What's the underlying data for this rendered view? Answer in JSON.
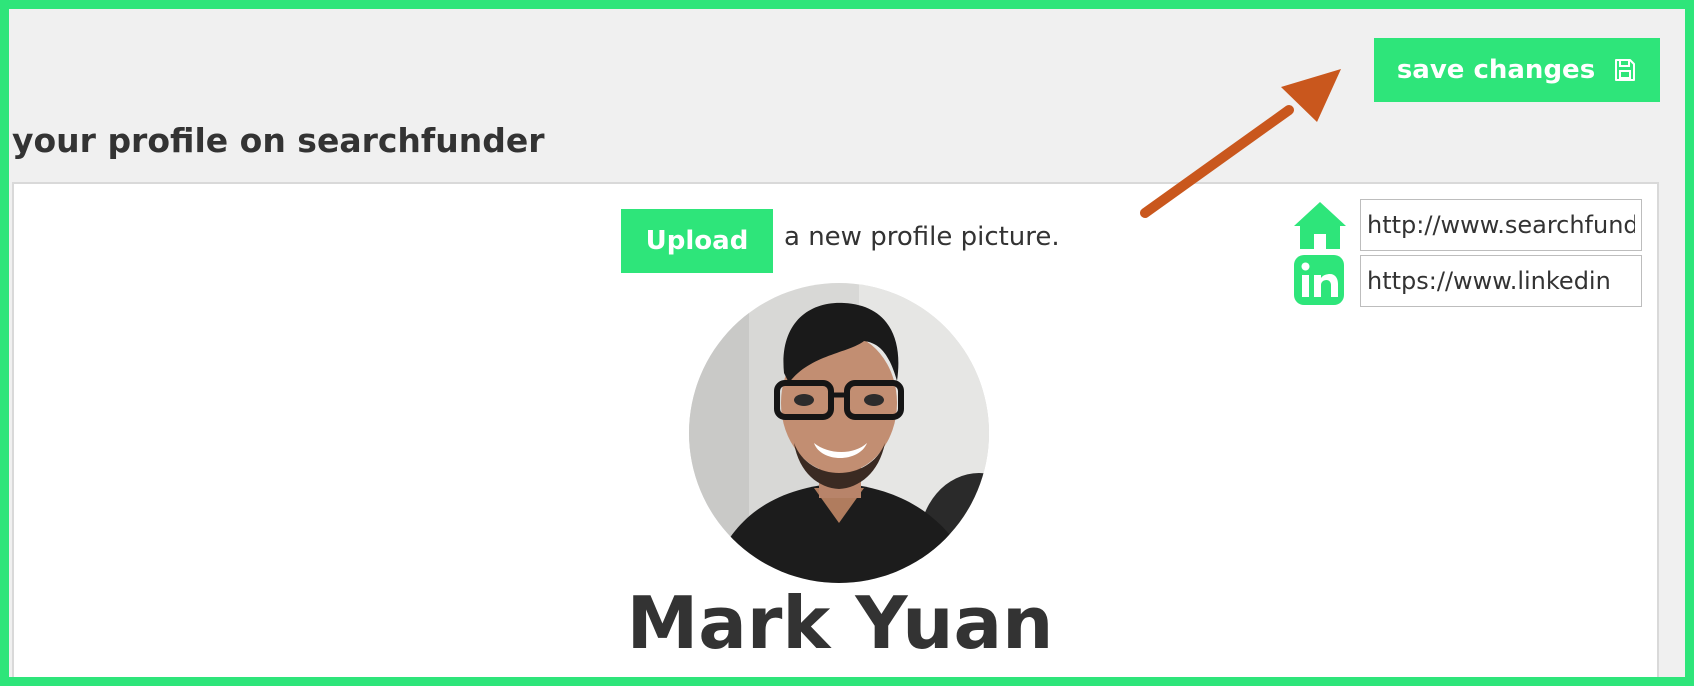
{
  "header": {
    "save_label": "save changes",
    "save_icon": "floppy-disk-icon"
  },
  "page": {
    "title": "your profile on searchfunder"
  },
  "profile": {
    "upload_label": "Upload",
    "upload_hint": "a new profile picture.",
    "name": "Mark Yuan"
  },
  "links": {
    "website_value": "http://www.searchfunder",
    "linkedin_value": "https://www.linkedin"
  },
  "colors": {
    "accent": "#2ee57a",
    "text": "#333333",
    "annotation_arrow": "#c9571d"
  }
}
